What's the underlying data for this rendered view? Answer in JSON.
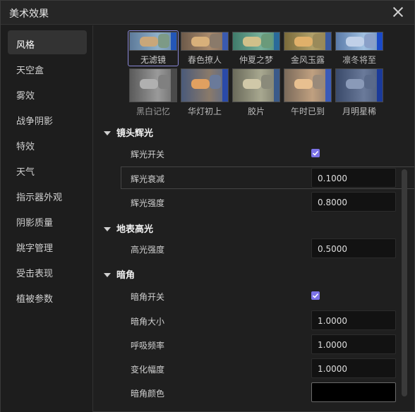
{
  "dialog": {
    "title": "美术效果"
  },
  "sidebar": {
    "items": [
      {
        "label": "风格",
        "active": true
      },
      {
        "label": "天空盒"
      },
      {
        "label": "雾效"
      },
      {
        "label": "战争阴影"
      },
      {
        "label": "特效"
      },
      {
        "label": "天气"
      },
      {
        "label": "指示器外观"
      },
      {
        "label": "阴影质量"
      },
      {
        "label": "跳字管理"
      },
      {
        "label": "受击表现"
      },
      {
        "label": "植被参数"
      }
    ]
  },
  "filters": {
    "row1": [
      "无滤镜",
      "春色撩人",
      "仲夏之梦",
      "金风玉露",
      "凛冬将至"
    ],
    "row2": [
      "黑白记忆",
      "华灯初上",
      "胶片",
      "午时已到",
      "月明星稀"
    ],
    "selected": "无滤镜"
  },
  "sections": {
    "lens_glow": {
      "title": "镜头辉光",
      "toggle_label": "辉光开关",
      "toggle_checked": true,
      "decay_label": "辉光衰减",
      "decay_value": "0.1000",
      "intensity_label": "辉光强度",
      "intensity_value": "0.8000"
    },
    "ground_highlight": {
      "title": "地表高光",
      "intensity_label": "高光强度",
      "intensity_value": "0.5000"
    },
    "vignette": {
      "title": "暗角",
      "toggle_label": "暗角开关",
      "toggle_checked": true,
      "size_label": "暗角大小",
      "size_value": "1.0000",
      "breath_label": "呼吸频率",
      "breath_value": "1.0000",
      "amplitude_label": "变化幅度",
      "amplitude_value": "1.0000",
      "color_label": "暗角颜色",
      "color_value": "#000000"
    }
  },
  "colors": {
    "accent": "#7b72e6",
    "panel": "#1f1f1f",
    "field": "#121212"
  }
}
